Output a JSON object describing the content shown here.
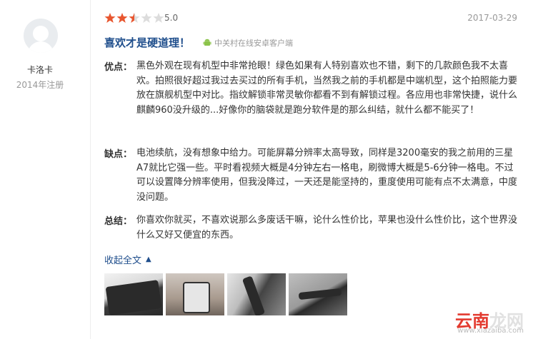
{
  "user": {
    "name": "卡洛卡",
    "reg_time": "2014年注册"
  },
  "review": {
    "rating": 2.5,
    "score": "5.0",
    "date": "2017-03-29",
    "title": "喜欢才是硬道理！",
    "source": "中关村在线安卓客户端",
    "sections": [
      {
        "label": "优点：",
        "text": "黑色外观在现有机型中非常抢眼！绿色如果有人特别喜欢也不错，剩下的几款颜色我不太喜欢。拍照很好超过我过去买过的所有手机，当然我之前的手机都是中端机型，这个拍照能力要放在旗舰机型中对比。指纹解锁非常灵敏你都看不到有解锁过程。各应用也非常快捷，说什么麒麟960没升级的...好像你的脑袋就是跑分软件是的那么纠结，就什么都不能买了！"
      },
      {
        "label": "缺点：",
        "text": "电池续航，没有想象中给力。可能屏幕分辨率太高导致，同样是3200毫安的我之前用的三星A7就比它强一些。平时看视频大概是4分钟左右一格电，刷微博大概是5-6分钟一格电。不过可以设置降分辨率使用，但我没降过，一天还是能坚持的，重度使用可能有点不太满意，中度没问题。"
      },
      {
        "label": "总结：",
        "text": "你喜欢你就买，不喜欢说那么多废话干嘛，论什么性价比，苹果也没什么性价比，这个世界没什么又好又便宜的东西。"
      }
    ],
    "collapse_label": "收起全文"
  },
  "watermark": {
    "text_red": "云南",
    "text_gray": "龙网",
    "small": "www.xiazaiba.com"
  },
  "colors": {
    "link": "#1f4e8c",
    "star_on": "#e8562f",
    "star_off": "#dcdcdc"
  }
}
